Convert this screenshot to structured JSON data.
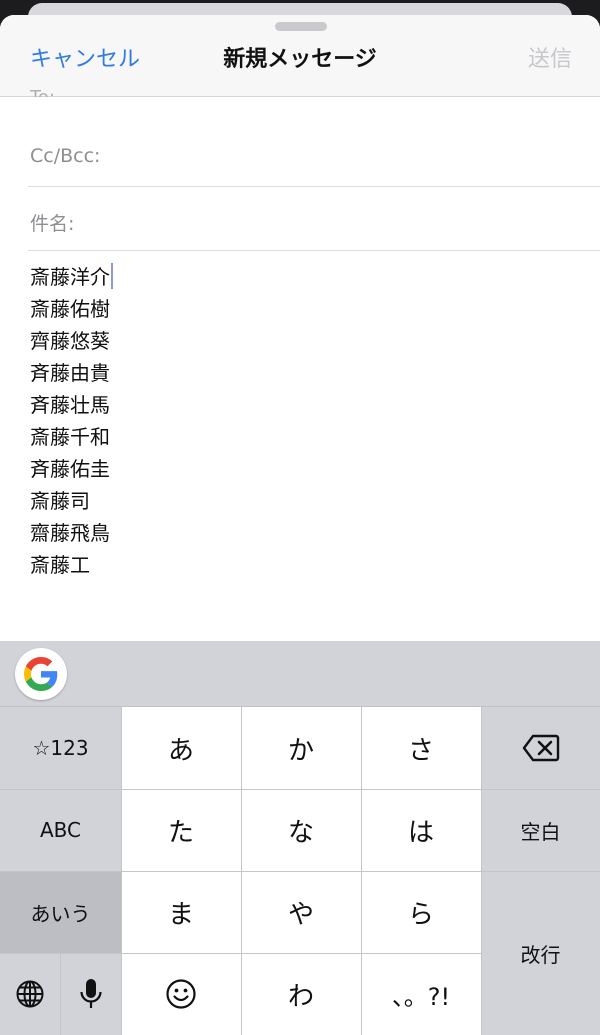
{
  "navbar": {
    "cancel_label": "キャンセル",
    "title": "新規メッセージ",
    "send_label": "送信"
  },
  "fields": {
    "partial_label": "To:",
    "cc_bcc_label": "Cc/Bcc:",
    "subject_label": "件名:"
  },
  "body": {
    "lines": [
      "斎藤洋介",
      "斎藤佑樹",
      "齊藤悠葵",
      "斉藤由貴",
      "斉藤壮馬",
      "斎藤千和",
      "斉藤佑圭",
      "斎藤司",
      "齋藤飛鳥",
      "斎藤工"
    ]
  },
  "keyboard": {
    "toolbar_icon": "google-g-icon",
    "keys": {
      "symbols": "☆123",
      "abc": "ABC",
      "kana": "あいう",
      "a": "あ",
      "ka": "か",
      "sa": "さ",
      "ta": "た",
      "na": "な",
      "ha": "は",
      "ma": "ま",
      "ya": "や",
      "ra": "ら",
      "emoji_icon": "smiley-icon",
      "wa": "わ",
      "punct": "、。?!",
      "space": "空白",
      "enter": "改行",
      "globe_icon": "globe-icon",
      "mic_icon": "microphone-icon",
      "delete_icon": "backspace-icon"
    }
  },
  "colors": {
    "accent": "#2f7ae5",
    "disabled": "#c7c7cc",
    "keyboard_bg": "#d1d3d9",
    "key_bg": "#ffffff"
  }
}
